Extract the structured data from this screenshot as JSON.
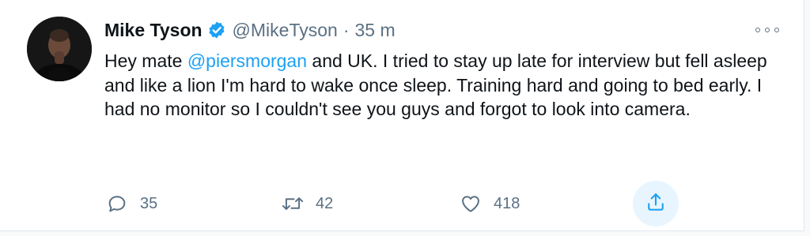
{
  "tweet": {
    "author": {
      "name": "Mike Tyson",
      "handle": "@MikeTyson",
      "verified_icon": "verified-badge-icon"
    },
    "separator": "·",
    "time": "35 m",
    "body": {
      "part1": "Hey mate ",
      "mention": "@piersmorgan",
      "part2": " and UK. I tried to stay up late for interview but fell asleep and like a lion I'm hard to wake once sleep.  Training hard and going to bed early.  I had no monitor so I couldn't see you guys and forgot to look into camera."
    },
    "actions": {
      "reply_count": "35",
      "retweet_count": "42",
      "like_count": "418"
    },
    "colors": {
      "link": "#1da1f2",
      "muted": "#5b7083",
      "share_bg": "#e8f5fe"
    }
  }
}
